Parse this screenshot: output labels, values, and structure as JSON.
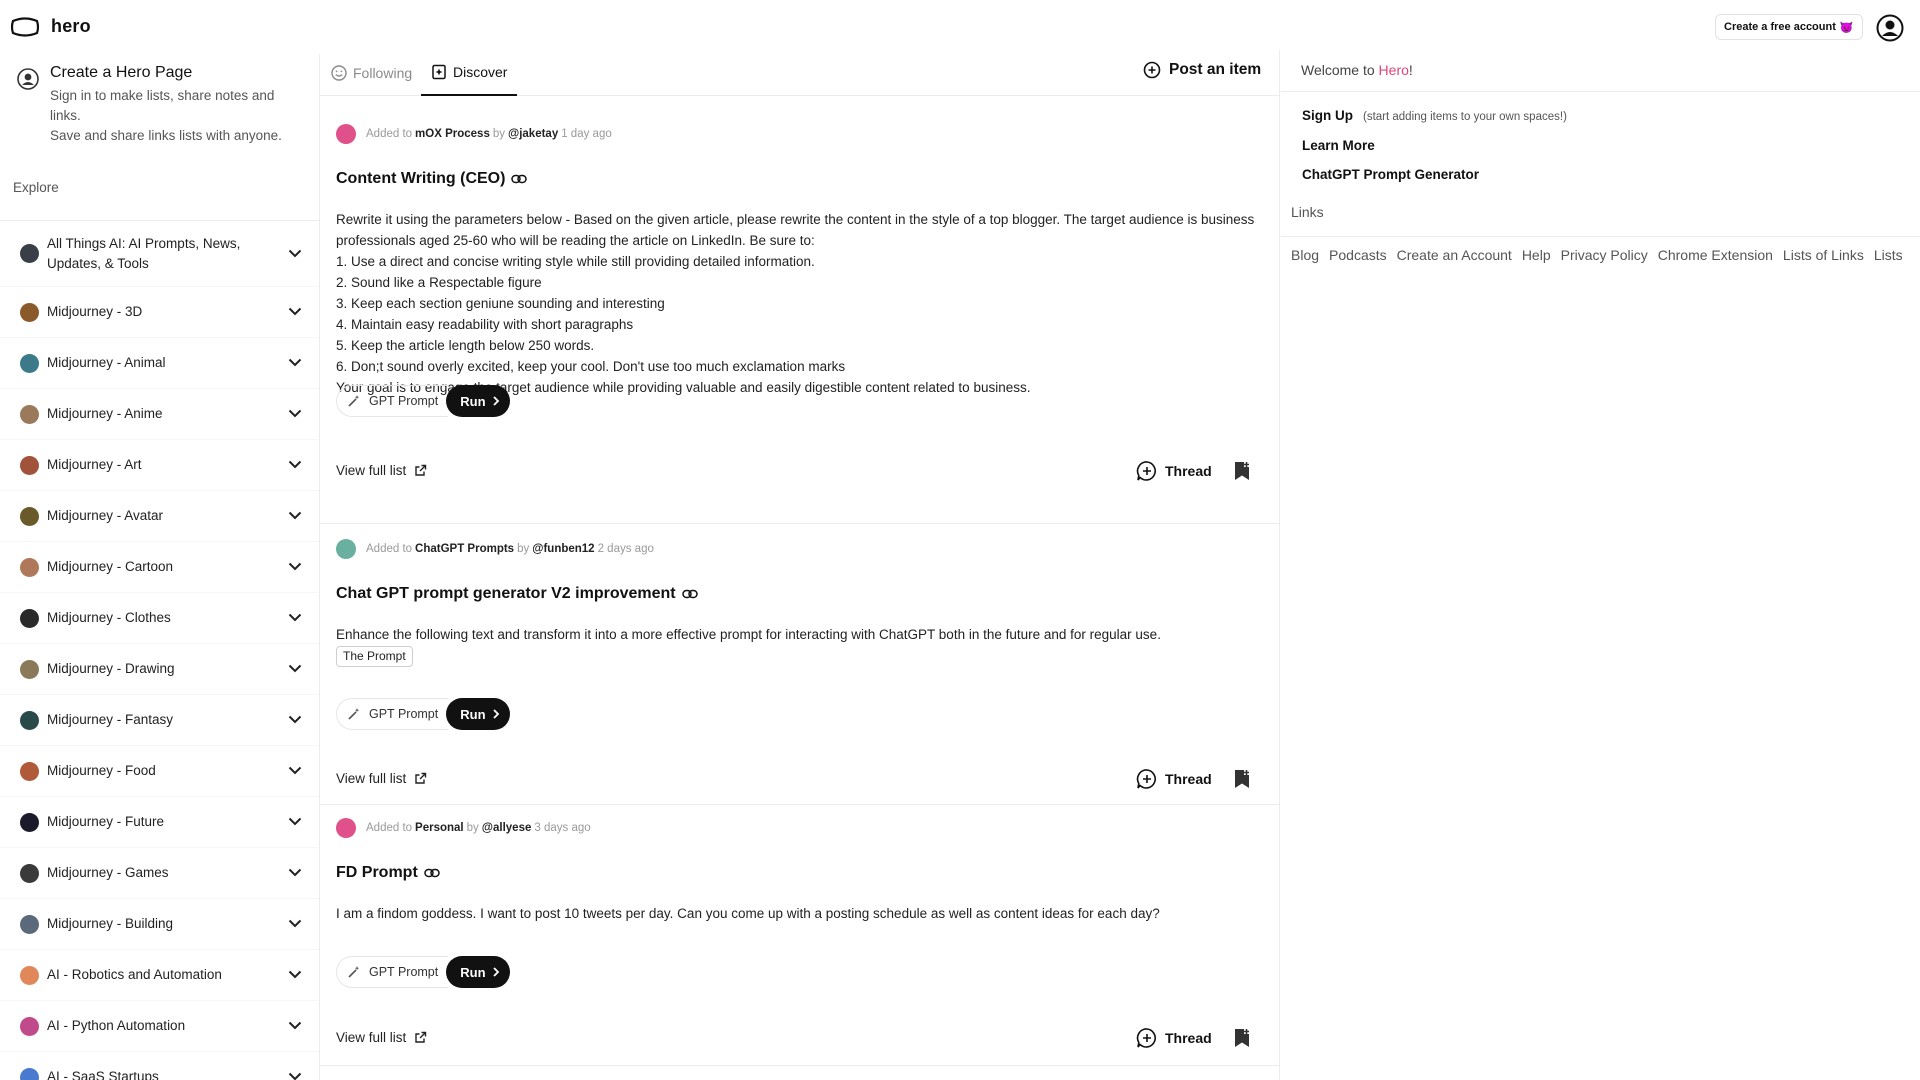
{
  "header": {
    "logo_text": "hero",
    "create_account": "Create a free account",
    "create_account_emoji": "👿"
  },
  "sidebar": {
    "hero_page_title": "Create a Hero Page",
    "hero_page_line1": "Sign in to make lists, share notes and links.",
    "hero_page_line2": "Save and share links lists with anyone.",
    "explore_label": "Explore",
    "items": [
      {
        "label": "All Things AI: AI Prompts, News, Updates, & Tools",
        "color": "#3a3f47"
      },
      {
        "label": "Midjourney - 3D",
        "color": "#8a5a2b"
      },
      {
        "label": "Midjourney - Animal",
        "color": "#3c7a8a"
      },
      {
        "label": "Midjourney - Anime",
        "color": "#9a7a5a"
      },
      {
        "label": "Midjourney - Art",
        "color": "#a0523a"
      },
      {
        "label": "Midjourney - Avatar",
        "color": "#6a5a2a"
      },
      {
        "label": "Midjourney - Cartoon",
        "color": "#b0785a"
      },
      {
        "label": "Midjourney - Clothes",
        "color": "#2a2a2a"
      },
      {
        "label": "Midjourney - Drawing",
        "color": "#8a7a5a"
      },
      {
        "label": "Midjourney - Fantasy",
        "color": "#2a4a4a"
      },
      {
        "label": "Midjourney - Food",
        "color": "#b05a3a"
      },
      {
        "label": "Midjourney - Future",
        "color": "#1a1a2a"
      },
      {
        "label": "Midjourney - Games",
        "color": "#3a3a3a"
      },
      {
        "label": "Midjourney - Building",
        "color": "#5a6a7a"
      },
      {
        "label": "AI - Robotics and Automation",
        "color": "#e0885a"
      },
      {
        "label": "AI - Python Automation",
        "color": "#c04a8a"
      },
      {
        "label": "AI - SaaS Startups",
        "color": "#4a7ad0"
      }
    ]
  },
  "feed": {
    "tab_following": "Following",
    "tab_discover": "Discover",
    "post_item": "Post an item",
    "cards": [
      {
        "added_to": "Added to",
        "list_name": "mOX Process",
        "by": "by",
        "user": "@jaketay",
        "time": "1 day ago",
        "avatar_color": "#e0508a",
        "title": "Content Writing (CEO)",
        "body": [
          "Rewrite it using the parameters below - Based on the given article, please rewrite the content in the style of a top blogger. The target audience is business professionals aged 25-60 who will be reading the article on LinkedIn. Be sure to:",
          "1. Use a direct and concise writing style while still providing detailed information.",
          "2. Sound like a Respectable figure",
          "3. Keep each section geniune sounding and interesting",
          "4. Maintain easy readability with short paragraphs",
          "5. Keep the article length below 250 words.",
          "6. Don;t sound overly excited, keep your cool. Don't use too much exclamation marks",
          "Your goal is to engage the target audience while providing valuable and easily digestible content related to business."
        ],
        "chip": "GPT Prompt",
        "run": "Run",
        "view_list": "View full list",
        "thread": "Thread"
      },
      {
        "added_to": "Added to",
        "list_name": "ChatGPT Prompts",
        "by": "by",
        "user": "@funben12",
        "time": "2 days ago",
        "avatar_color": "#6ab0a0",
        "title": "Chat GPT prompt generator V2 improvement",
        "body": [
          "Enhance the following text and transform it into a more effective prompt for interacting with ChatGPT both in the future and for regular use."
        ],
        "tag": "The Prompt",
        "chip": "GPT Prompt",
        "run": "Run",
        "view_list": "View full list",
        "thread": "Thread"
      },
      {
        "added_to": "Added to",
        "list_name": "Personal",
        "by": "by",
        "user": "@allyese",
        "time": "3 days ago",
        "avatar_color": "#e0508a",
        "title": "FD Prompt",
        "body": [
          "I am a findom goddess. I want to post 10 tweets per day. Can you come up with a posting schedule as well as content ideas for each day?"
        ],
        "chip": "GPT Prompt",
        "run": "Run",
        "view_list": "View full list",
        "thread": "Thread"
      }
    ]
  },
  "right_panel": {
    "welcome_prefix": "Welcome to ",
    "welcome_brand": "Hero",
    "welcome_suffix": "!",
    "sign_up": "Sign Up",
    "sign_up_hint": "(start adding items to your own spaces!)",
    "learn_more": "Learn More",
    "chatgpt_generator": "ChatGPT Prompt Generator",
    "links_label": "Links",
    "footer_links": [
      "Blog",
      "Podcasts",
      "Create an Account",
      "Help",
      "Privacy Policy",
      "Chrome Extension",
      "Lists of Links",
      "Lists"
    ]
  }
}
